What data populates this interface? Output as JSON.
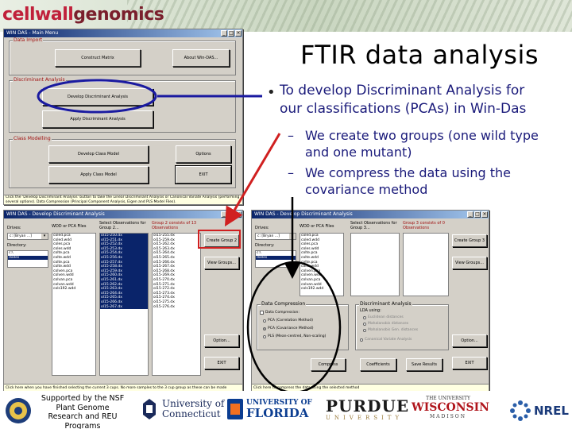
{
  "banner": {
    "logo_part1": "cellwall",
    "logo_part2": "genomics"
  },
  "slide": {
    "title": "FTIR data analysis",
    "bullet_marker": "•",
    "bullet_text": "To develop Discriminant Analysis for our classifications (PCAs) in Win-Das",
    "sub_marker": "–",
    "sub1": "We create two groups (one wild type and one mutant)",
    "sub2": "We compress the data using the covariance method"
  },
  "main_menu": {
    "title": "WIN DAS - Main Menu",
    "menu": "",
    "data_import_label": "Data Import",
    "construct_matrix": "Construct Matrix",
    "about": "About Win-DAS...",
    "discriminant_label": "Discriminant Analysis",
    "develop_da": "Develop Discriminant Analysis",
    "apply_da": "Apply Discriminant Analysis",
    "class_modelling_label": "Class Modelling",
    "develop_class_model": "Develop Class Model",
    "options": "Options",
    "apply_class_model": "Apply Class Model",
    "exit": "EXIT",
    "status": "Click the 'Develop Discriminant Analysis' button to take the Linear Discriminant Analysis or Canonical Variate Analysis (performing several options). Data Compression (Principal Component Analysis, Eigen and PLS Model Files)."
  },
  "da_window_1": {
    "title": "WIN DAS - Develop Discriminant Analysis",
    "drives_label": "Drives:",
    "drive_value": "c: [Bryan ...]",
    "directory_label": "Directory:",
    "dirs": [
      "c:\\",
      "dalles"
    ],
    "files_label": "WDD or PCA Files",
    "files": [
      "coled.pca",
      "coled.wdd",
      "coles.pca",
      "coles.wdd",
      "colte.pca",
      "colte.wdd",
      "colte.pca",
      "colte.wdd",
      "colven.pca",
      "colven.wdd",
      "colvan.pca",
      "colvan.wdd",
      "cols192.wdd"
    ],
    "g1_label": "Select Observations for Group 2...",
    "g1": [
      "ol15-250.dx",
      "ol15-251.dx",
      "ol15-252.dx",
      "ol15-253.dx",
      "ol15-254.dx",
      "ol15-256.dx",
      "ol15-257.dx",
      "ol15-258.dx",
      "ol15-259.dx",
      "ol15-260.dx",
      "ol15-261.dx",
      "ol15-262.dx",
      "ol15-263.dx",
      "ol15-264.dx",
      "ol15-265.dx",
      "ol15-266.dx",
      "ol15-267.dx"
    ],
    "g2_label": "Group 2 consists of 13 Observations",
    "g2": [
      "ol15-255.dx",
      "ol15-259.dx",
      "ol15-262.dx",
      "ol15-263.dx",
      "ol15-264.dx",
      "ol15-265.dx",
      "ol15-266.dx",
      "ol15-267.dx",
      "ol15-268.dx",
      "ol15-269.dx",
      "ol15-270.dx",
      "ol15-271.dx",
      "ol15-272.dx",
      "ol15-273.dx",
      "ol15-274.dx",
      "ol15-275.dx",
      "ol15-276.dx"
    ],
    "create_group": "Create Group 2",
    "view_groups": "View Groups...",
    "option": "Option...",
    "exit": "EXIT",
    "status": "Click here when you have finished selecting the current 3 cups. No more samples to the 3 cup group as these can be made"
  },
  "da_window_2": {
    "title": "WIN DAS - Develop Discriminant Analysis",
    "drives_label": "Drives:",
    "drive_value": "c: [Bryan ...]",
    "directory_label": "Directory:",
    "dirs": [
      "c:\\",
      "dalles"
    ],
    "files_label": "WDD or PCA Files",
    "files": [
      "coled.pca",
      "coled.wdd",
      "coles.pca",
      "coles.wdd",
      "colte.pca",
      "colte.wdd",
      "colte.pca",
      "colte.wdd",
      "colven.pca",
      "colven.wdd",
      "colvan.pca",
      "colvan.wdd",
      "cols192.wdd"
    ],
    "g1_label": "Select Observations for Group 3...",
    "g2_label": "Group 3 consists of 0 Observations",
    "create_group": "Create Group 3",
    "view_groups": "View Groups...",
    "compression_label": "Data Compression",
    "compression_check": "Data Compression:",
    "pca_corr": "PCA (Correlation Method)",
    "pca_cov": "PCA (Covariance Method)",
    "pls": "PLS (Mean-centred, Non-scaling)",
    "da_label": "Discriminant Analysis",
    "lda_using": "LDA using:",
    "lda_opts": [
      "Euclidean distances",
      "Mahalanobis distances",
      "Mahalanobis Gen. distances"
    ],
    "cva": "Canonical Variate Analysis",
    "compress": "Compress",
    "coefficients": "Coefficients",
    "save_results": "Save Results",
    "option": "Option...",
    "exit": "EXIT",
    "status": "Click here to compress the data using the selected method"
  },
  "footer": {
    "nsf": "Supported by the NSF Plant Genome Research and REU Programs",
    "uconn1": "University of",
    "uconn2": "Connecticut",
    "uf1": "UNIVERSITY OF",
    "uf2": "FLORIDA",
    "purdue1": "PURDUE",
    "purdue2": "UNIVERSITY",
    "wisc1": "THE UNIVERSITY",
    "wisc2": "WISCONSIN",
    "wisc3": "MADISON",
    "nrel": "NREL"
  },
  "colors": {
    "accent_text": "#1a1a7a",
    "titlebar": "#0a246a",
    "window_bg": "#d4d0c8",
    "annotation": "#1a1aa0",
    "arrow": "#d02020"
  }
}
